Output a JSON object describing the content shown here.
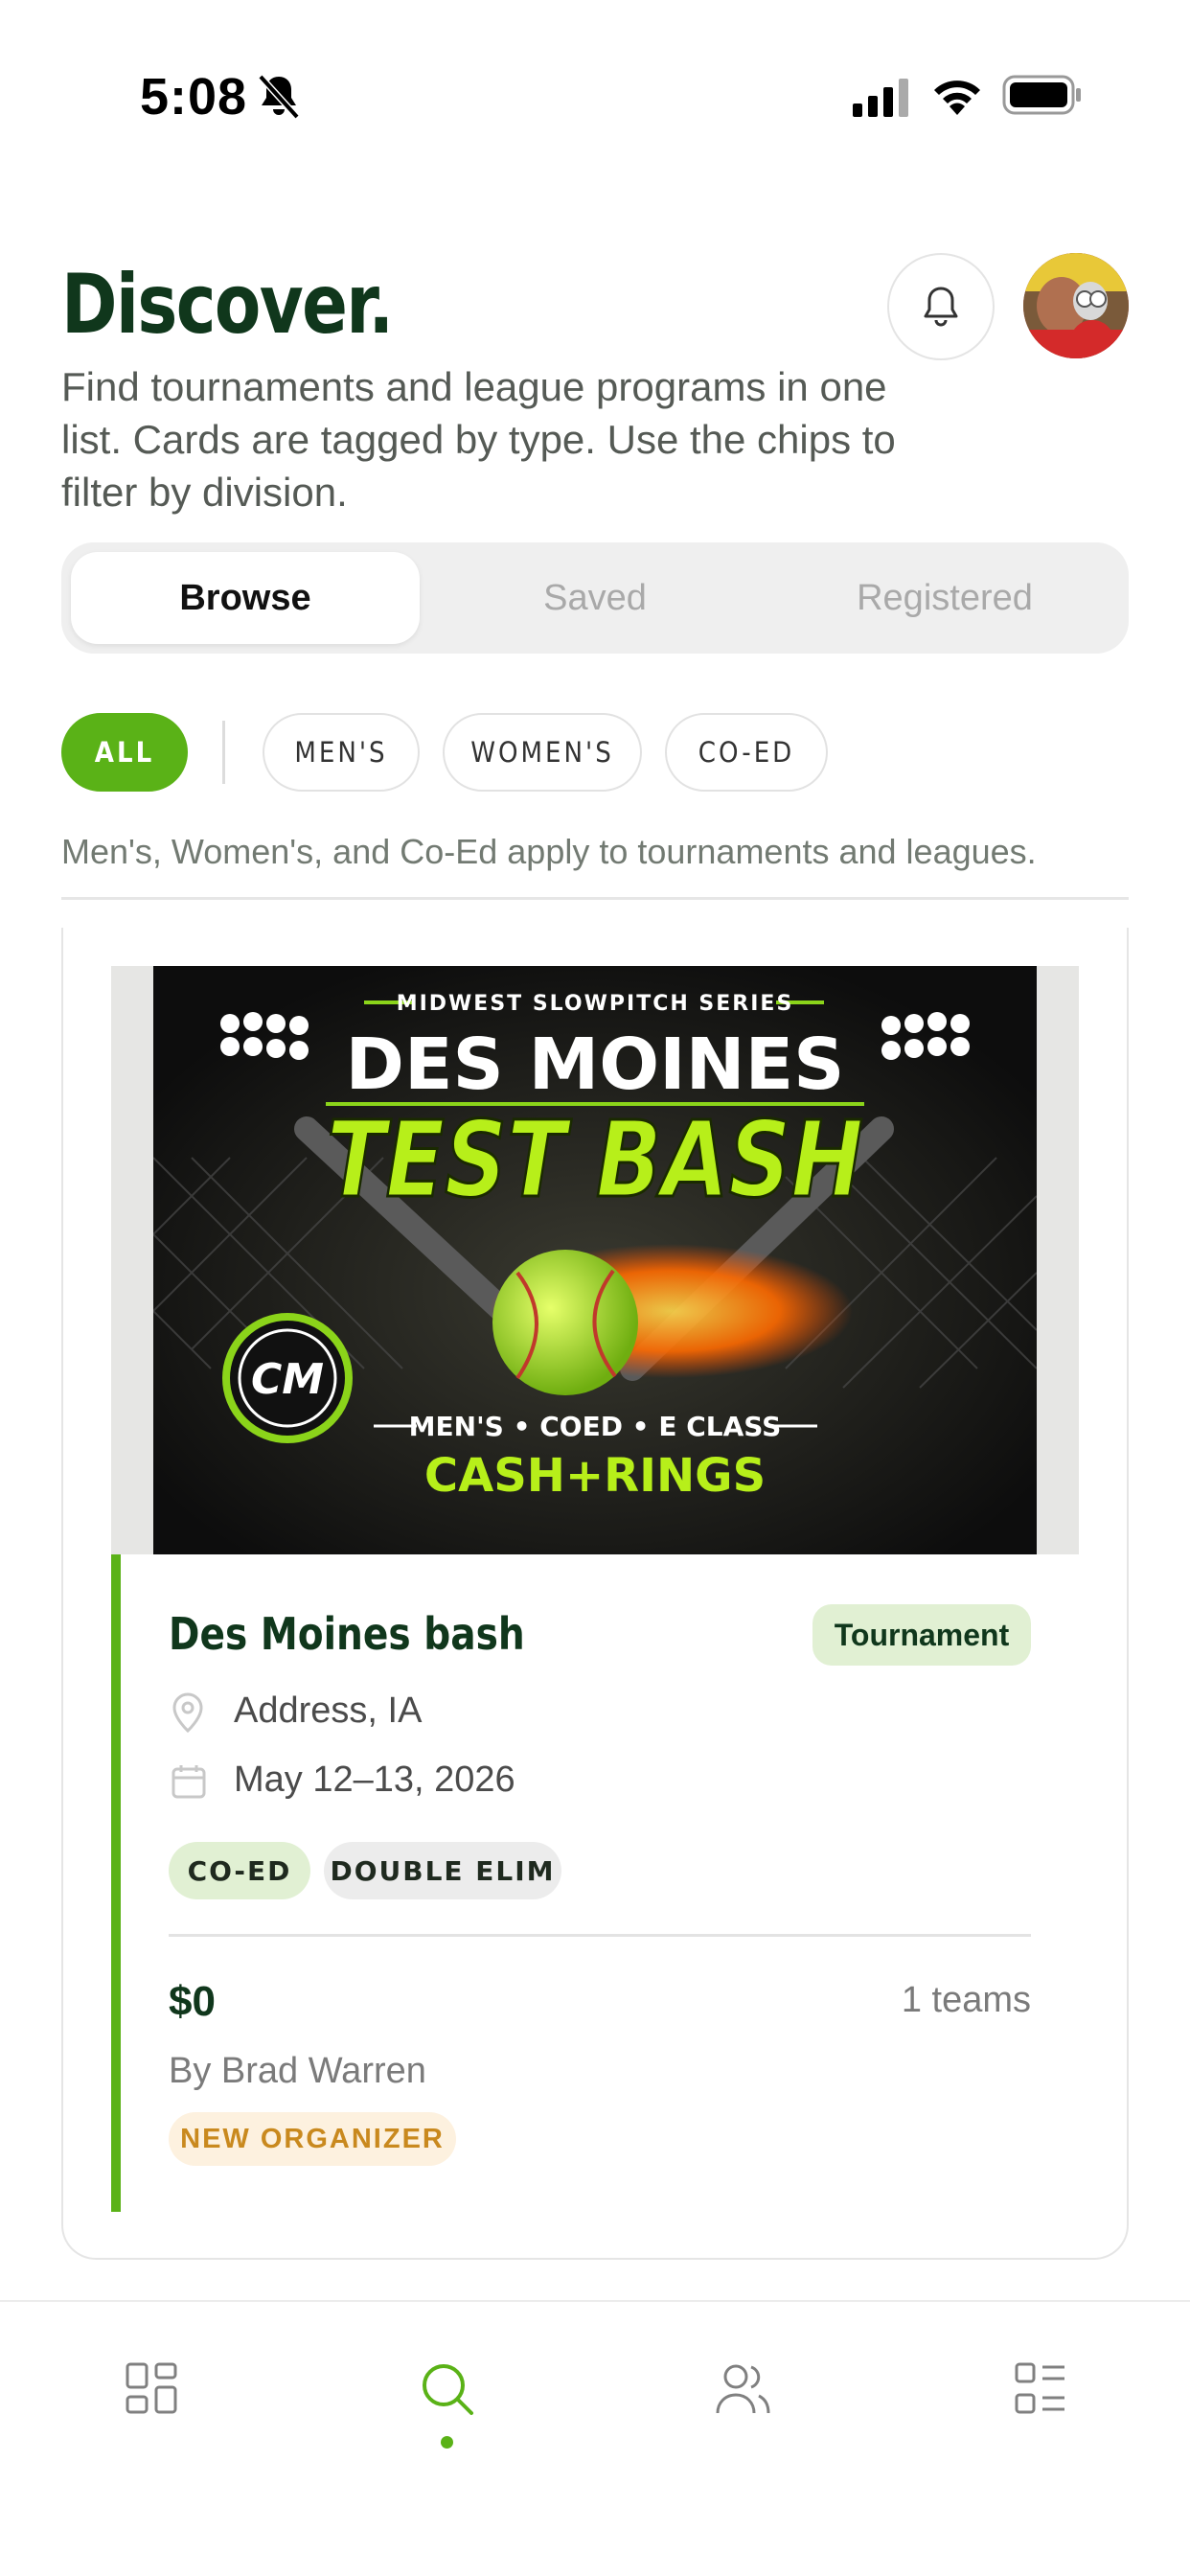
{
  "status_bar": {
    "time": "5:08"
  },
  "header": {
    "title": "Discover.",
    "subtitle": "Find tournaments and league programs in one list. Cards are tagged by type. Use the chips to filter by division."
  },
  "segments": [
    {
      "label": "Browse",
      "active": true
    },
    {
      "label": "Saved",
      "active": false
    },
    {
      "label": "Registered",
      "active": false
    }
  ],
  "chips": [
    {
      "label": "ALL",
      "active": true
    },
    {
      "label": "MEN'S",
      "active": false
    },
    {
      "label": "WOMEN'S",
      "active": false
    },
    {
      "label": "CO-ED",
      "active": false
    }
  ],
  "filter_hint": "Men's, Women's, and Co-Ed apply to tournaments and leagues.",
  "event": {
    "poster": {
      "series": "MIDWEST SLOWPITCH SERIES",
      "line1": "DES MOINES",
      "line2": "TEST BASH",
      "logo": "CM",
      "divisions": "MEN'S • COED • E CLASS",
      "prizes": "CASH+RINGS"
    },
    "title": "Des Moines bash",
    "type": "Tournament",
    "location": "Address, IA",
    "dates": "May 12–13, 2026",
    "tags": [
      "CO-ED",
      "DOUBLE ELIM"
    ],
    "price": "$0",
    "teams": "1 teams",
    "organizer": "By Brad Warren",
    "organizer_badge": "NEW ORGANIZER"
  },
  "colors": {
    "accent": "#5ab217",
    "title_green": "#10371c",
    "badge_green_bg": "#e1f0d3",
    "organizer_badge_text": "#c9891e"
  },
  "nav": {
    "items": [
      "grid-icon",
      "search-icon",
      "people-icon",
      "list-icon"
    ],
    "active": "search-icon"
  }
}
